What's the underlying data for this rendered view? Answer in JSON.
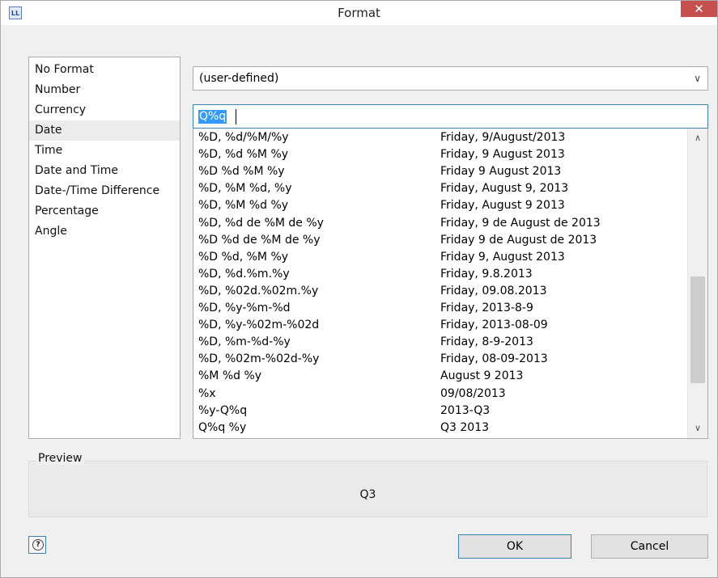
{
  "window": {
    "title": "Format",
    "app_icon": "LL",
    "close_glyph": "✕"
  },
  "categories": [
    {
      "label": "No Format"
    },
    {
      "label": "Number"
    },
    {
      "label": "Currency"
    },
    {
      "label": "Date",
      "selected": true
    },
    {
      "label": "Time"
    },
    {
      "label": "Date and Time"
    },
    {
      "label": "Date-/Time Difference"
    },
    {
      "label": "Percentage"
    },
    {
      "label": "Angle"
    }
  ],
  "format_select": {
    "value": "(user-defined)",
    "chevron": "∨"
  },
  "format_input": {
    "value": "Q%q"
  },
  "format_list": [
    {
      "format": "%D, %d/%M/%y",
      "example": "Friday, 9/August/2013"
    },
    {
      "format": "%D, %d %M %y",
      "example": "Friday, 9 August 2013"
    },
    {
      "format": "%D %d %M %y",
      "example": "Friday 9 August 2013"
    },
    {
      "format": "%D, %M %d, %y",
      "example": "Friday, August 9, 2013"
    },
    {
      "format": "%D, %M %d %y",
      "example": "Friday, August 9 2013"
    },
    {
      "format": "%D, %d de %M de %y",
      "example": "Friday, 9 de August de 2013"
    },
    {
      "format": "%D %d de %M de %y",
      "example": "Friday 9 de August de 2013"
    },
    {
      "format": "%D %d, %M %y",
      "example": "Friday 9, August 2013"
    },
    {
      "format": "%D, %d.%m.%y",
      "example": "Friday, 9.8.2013"
    },
    {
      "format": "%D, %02d.%02m.%y",
      "example": "Friday, 09.08.2013"
    },
    {
      "format": "%D, %y-%m-%d",
      "example": "Friday, 2013-8-9"
    },
    {
      "format": "%D, %y-%02m-%02d",
      "example": "Friday, 2013-08-09"
    },
    {
      "format": "%D, %m-%d-%y",
      "example": "Friday, 8-9-2013"
    },
    {
      "format": "%D, %02m-%02d-%y",
      "example": "Friday, 08-09-2013"
    },
    {
      "format": "%M %d %y",
      "example": "August 9 2013"
    },
    {
      "format": "%x",
      "example": "09/08/2013"
    },
    {
      "format": "%y-Q%q",
      "example": "2013-Q3"
    },
    {
      "format": "Q%q %y",
      "example": "Q3 2013"
    }
  ],
  "scrollbar": {
    "up_glyph": "∧",
    "down_glyph": "∨",
    "position_fraction": 0.78
  },
  "preview": {
    "label": "Preview",
    "value": "Q3"
  },
  "buttons": {
    "help_glyph": "?",
    "ok": "OK",
    "cancel": "Cancel"
  }
}
